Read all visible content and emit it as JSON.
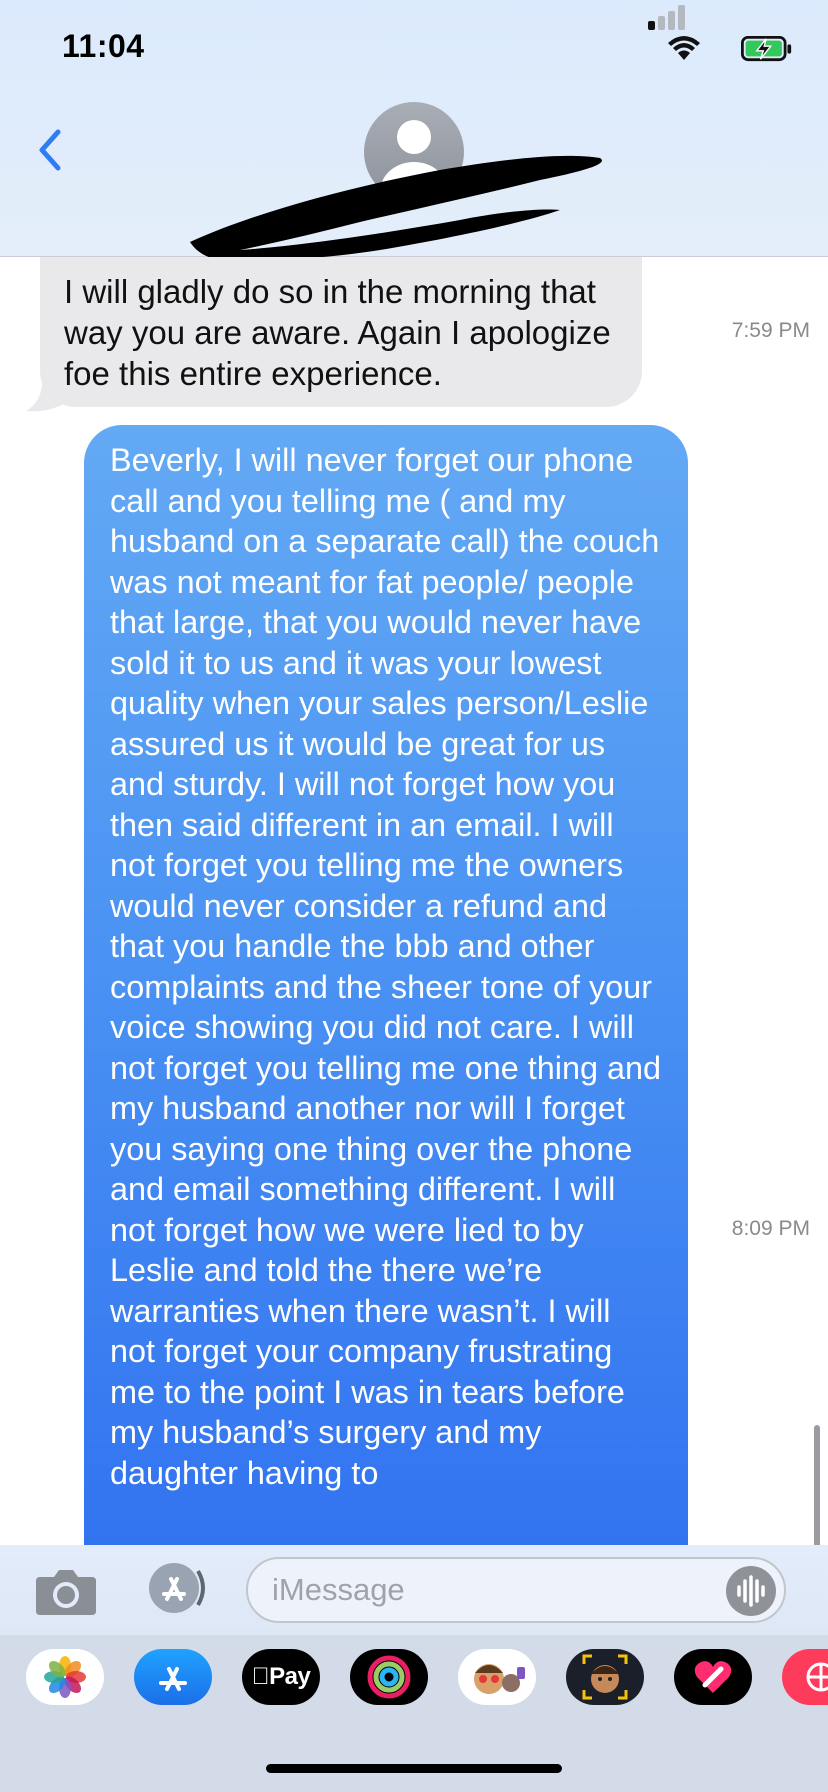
{
  "status_bar": {
    "time": "11:04"
  },
  "header": {
    "contact_name_redacted": true
  },
  "messages": [
    {
      "direction": "incoming",
      "text": "I will gladly do so in the morning that way you are aware.  Again I apologize foe this entire experience.",
      "timestamp": "7:59 PM"
    },
    {
      "direction": "outgoing",
      "text": "Beverly, I will never forget our phone call and you telling me ( and my husband on a separate call) the couch was not meant for fat people/ people that large, that you would never have sold it to us and it was your lowest quality when your sales person/Leslie assured us it would be great for us and sturdy. I will not forget how you then said different in an email. I will not forget you telling me the owners would never consider a refund and that you handle the bbb and other complaints and the sheer tone of your voice showing you did not care. I will not forget you telling me one thing and my husband another nor will I forget you saying one thing over the phone and email something different. I will not forget how we were lied to by Leslie and told the there we’re warranties when there wasn’t. I will not forget your company frustrating me to the point I was in tears before my husband’s surgery and my daughter having to",
      "timestamp": "8:09 PM"
    }
  ],
  "input": {
    "placeholder": "iMessage"
  },
  "app_drawer": {
    "apple_pay_label": "Pay"
  },
  "colors": {
    "outgoing_bubble": "#3b82f6",
    "incoming_bubble": "#e9e9eb",
    "accent": "#2f7cf6",
    "header_bg": "#dbeafc"
  }
}
